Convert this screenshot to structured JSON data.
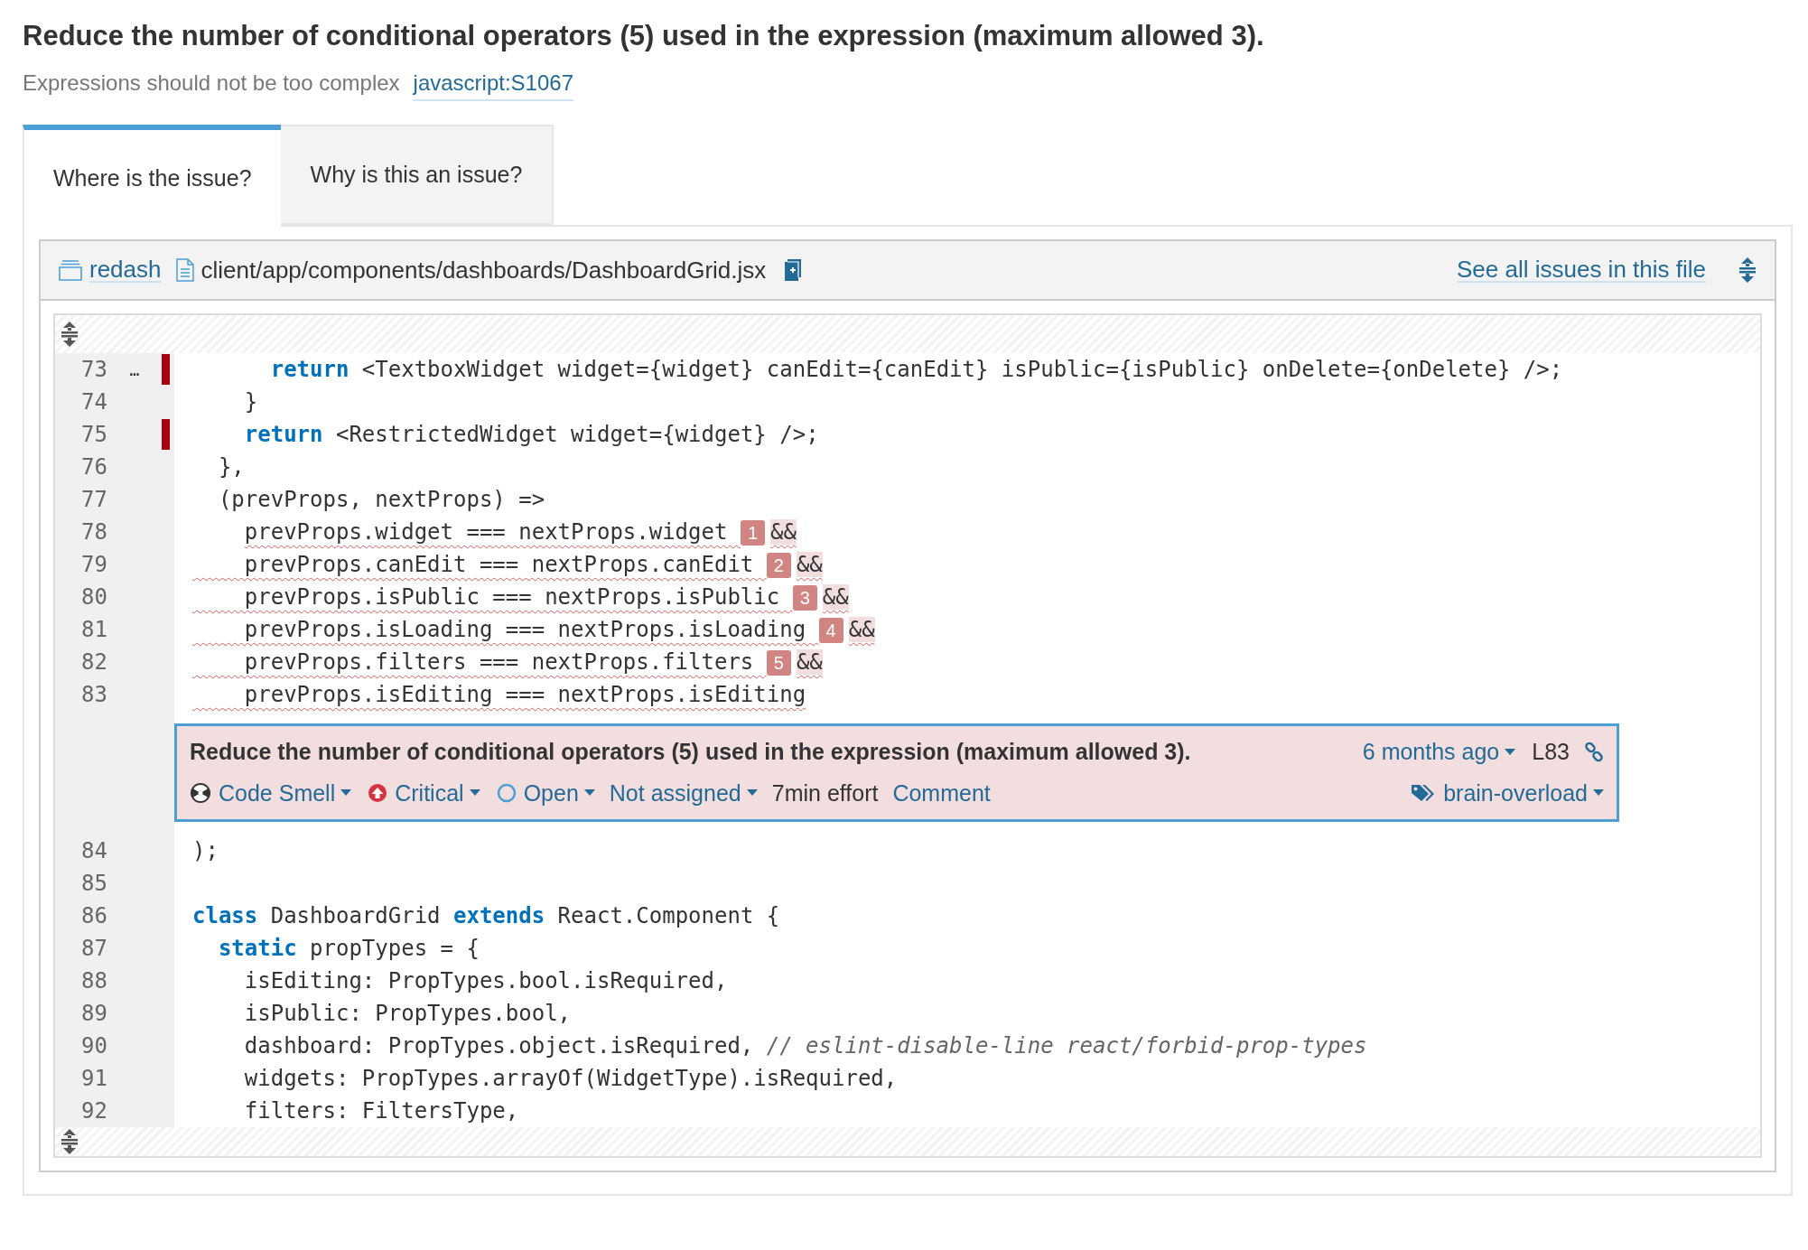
{
  "title": "Reduce the number of conditional operators (5) used in the expression (maximum allowed 3).",
  "subtitle": {
    "text": "Expressions should not be too complex",
    "rule_link": "javascript:S1067"
  },
  "tabs": [
    {
      "label": "Where is the issue?",
      "selected": true
    },
    {
      "label": "Why is this an issue?",
      "selected": false
    }
  ],
  "file_header": {
    "project": "redash",
    "path": "client/app/components/dashboards/DashboardGrid.jsx",
    "see_all_link": "See all issues in this file"
  },
  "code_lines_before": [
    {
      "number": "73",
      "marker": true,
      "gutter_mark": "…",
      "segments": [
        {
          "kind": "keyword",
          "text": "      return"
        },
        {
          "kind": "plain",
          "text": " <TextboxWidget widget={widget} canEdit={canEdit} isPublic={isPublic} onDelete={onDelete} />;"
        }
      ]
    },
    {
      "number": "74",
      "marker": false,
      "segments": [
        {
          "kind": "plain",
          "text": "    }"
        }
      ]
    },
    {
      "number": "75",
      "marker": true,
      "segments": [
        {
          "kind": "keyword",
          "text": "    return"
        },
        {
          "kind": "plain",
          "text": " <RestrictedWidget widget={widget} />;"
        }
      ]
    },
    {
      "number": "76",
      "marker": false,
      "segments": [
        {
          "kind": "plain",
          "text": "  },"
        }
      ]
    },
    {
      "number": "77",
      "marker": false,
      "segments": [
        {
          "kind": "plain",
          "text": "  (prevProps, nextProps) =>"
        }
      ]
    },
    {
      "number": "78",
      "marker": false,
      "segments": [
        {
          "kind": "flagged_start",
          "text": "    prevProps.widget === nextProps.widget "
        },
        {
          "kind": "badge",
          "text": "1"
        },
        {
          "kind": "flagged_op",
          "text": "&&"
        }
      ]
    },
    {
      "number": "79",
      "marker": false,
      "segments": [
        {
          "kind": "flagged",
          "text": "    prevProps.canEdit === nextProps.canEdit "
        },
        {
          "kind": "badge",
          "text": "2"
        },
        {
          "kind": "flagged_op",
          "text": "&&"
        }
      ]
    },
    {
      "number": "80",
      "marker": false,
      "segments": [
        {
          "kind": "flagged",
          "text": "    prevProps.isPublic === nextProps.isPublic "
        },
        {
          "kind": "badge",
          "text": "3"
        },
        {
          "kind": "flagged_op",
          "text": "&&"
        }
      ]
    },
    {
      "number": "81",
      "marker": false,
      "segments": [
        {
          "kind": "flagged",
          "text": "    prevProps.isLoading === nextProps.isLoading "
        },
        {
          "kind": "badge",
          "text": "4"
        },
        {
          "kind": "flagged_op",
          "text": "&&"
        }
      ]
    },
    {
      "number": "82",
      "marker": false,
      "segments": [
        {
          "kind": "flagged",
          "text": "    prevProps.filters === nextProps.filters "
        },
        {
          "kind": "badge",
          "text": "5"
        },
        {
          "kind": "flagged_op",
          "text": "&&"
        }
      ]
    },
    {
      "number": "83",
      "marker": false,
      "segments": [
        {
          "kind": "flagged",
          "text": "    prevProps.isEditing === nextProps.isEditing"
        }
      ]
    }
  ],
  "issue": {
    "message": "Reduce the number of conditional operators (5) used in the expression (maximum allowed 3).",
    "age": "6 months ago",
    "line": "L83",
    "type": "Code Smell",
    "severity": "Critical",
    "status": "Open",
    "assignee": "Not assigned",
    "effort": "7min effort",
    "comment_link": "Comment",
    "tags": "brain-overload"
  },
  "code_lines_after": [
    {
      "number": "84",
      "marker": false,
      "segments": [
        {
          "kind": "plain",
          "text": ");"
        }
      ]
    },
    {
      "number": "85",
      "marker": false
    },
    {
      "number": "86",
      "marker": false,
      "segments": [
        {
          "kind": "keyword",
          "text": "class"
        },
        {
          "kind": "plain",
          "text": " DashboardGrid "
        },
        {
          "kind": "keyword",
          "text": "extends"
        },
        {
          "kind": "plain",
          "text": " React.Component {"
        }
      ]
    },
    {
      "number": "87",
      "marker": false,
      "segments": [
        {
          "kind": "keyword",
          "text": "  static"
        },
        {
          "kind": "plain",
          "text": " propTypes = {"
        }
      ]
    },
    {
      "number": "88",
      "marker": false,
      "segments": [
        {
          "kind": "plain",
          "text": "    isEditing: PropTypes.bool.isRequired,"
        }
      ]
    },
    {
      "number": "89",
      "marker": false,
      "segments": [
        {
          "kind": "plain",
          "text": "    isPublic: PropTypes.bool,"
        }
      ]
    },
    {
      "number": "90",
      "marker": false,
      "segments": [
        {
          "kind": "plain",
          "text": "    dashboard: PropTypes.object.isRequired, "
        },
        {
          "kind": "comment",
          "text": "// eslint-disable-line react/forbid-prop-types"
        }
      ]
    },
    {
      "number": "91",
      "marker": false,
      "segments": [
        {
          "kind": "plain",
          "text": "    widgets: PropTypes.arrayOf(WidgetType).isRequired,"
        }
      ]
    },
    {
      "number": "92",
      "marker": false,
      "segments": [
        {
          "kind": "plain",
          "text": "    filters: FiltersType,"
        }
      ]
    }
  ]
}
